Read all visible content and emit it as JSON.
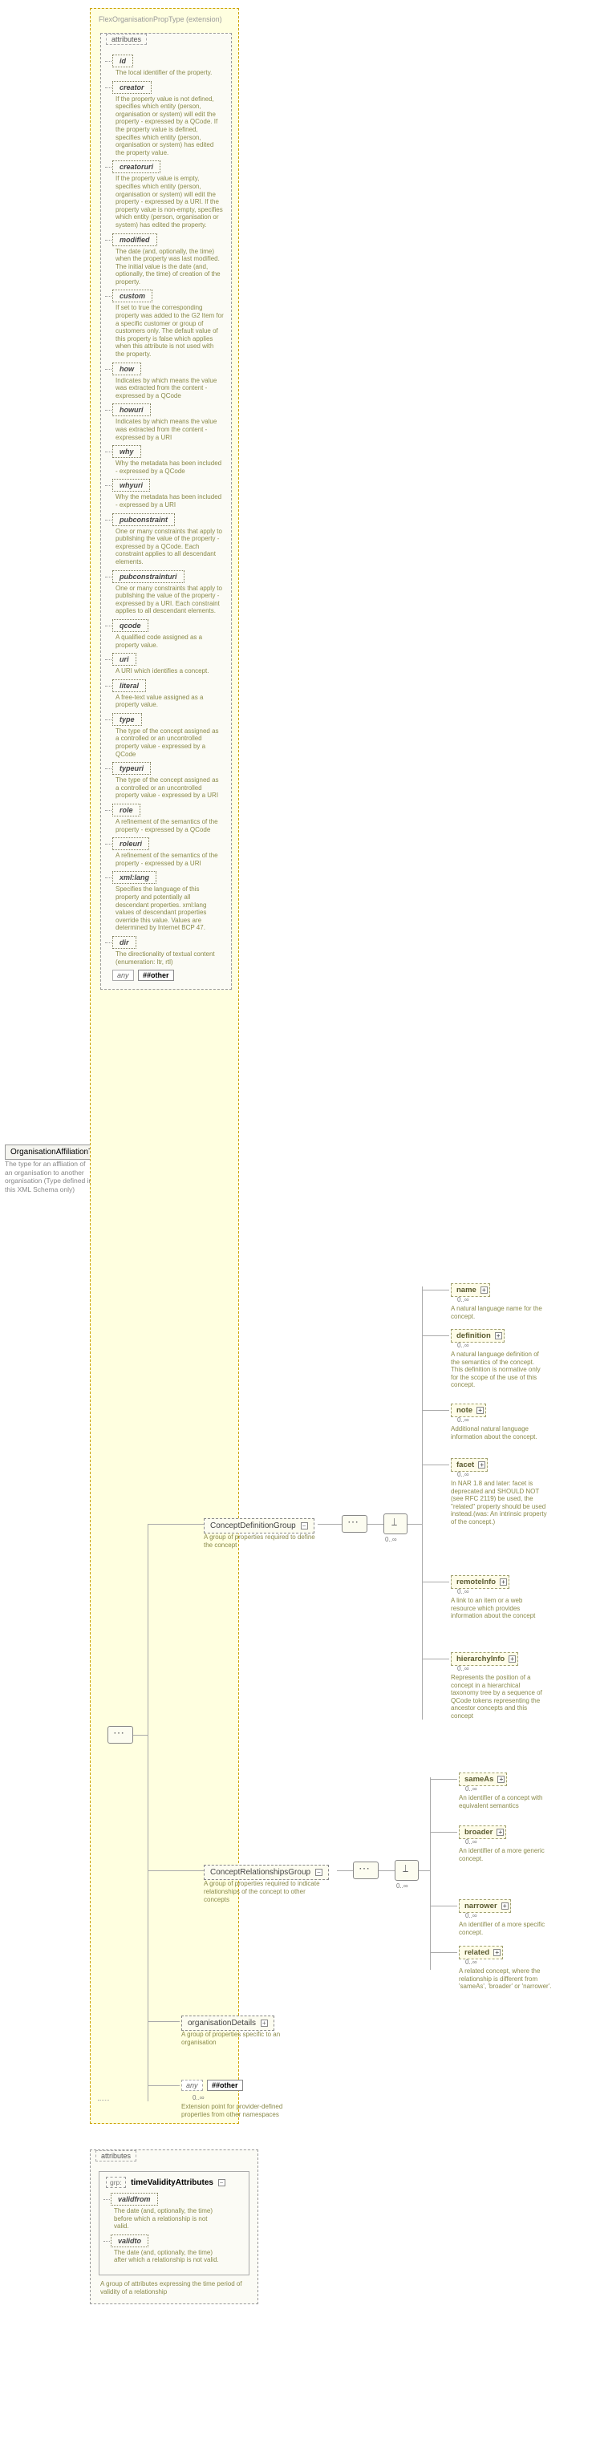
{
  "root": {
    "name": "OrganisationAffiliationType",
    "desc": "The type for an affliation of an organisation to another organisation (Type defined in this XML Schema only)"
  },
  "ext": {
    "label": "FlexOrganisationPropType (extension)"
  },
  "attributes_label": "attributes",
  "any_label": "any",
  "hash_label": "##other",
  "hash_ext_card": "0..∞",
  "hash_ext_desc": "Extension point for provider-defined properties from other namespaces",
  "flex_attrs": [
    {
      "name": "id",
      "desc": "The local identifier of the property."
    },
    {
      "name": "creator",
      "desc": "If the property value is not defined, specifies which entity (person, organisation or system) will edit the property - expressed by a QCode. If the property value is defined, specifies which entity (person, organisation or system) has edited the property value."
    },
    {
      "name": "creatoruri",
      "desc": "If the property value is empty, specifies which entity (person, organisation or system) will edit the property - expressed by a URI. If the property value is non-empty, specifies which entity (person, organisation or system) has edited the property."
    },
    {
      "name": "modified",
      "desc": "The date (and, optionally, the time) when the property was last modified. The initial value is the date (and, optionally, the time) of creation of the property."
    },
    {
      "name": "custom",
      "desc": "If set to true the corresponding property was added to the G2 Item for a specific customer or group of customers only. The default value of this property is false which applies when this attribute is not used with the property."
    },
    {
      "name": "how",
      "desc": "Indicates by which means the value was extracted from the content - expressed by a QCode"
    },
    {
      "name": "howuri",
      "desc": "Indicates by which means the value was extracted from the content - expressed by a URI"
    },
    {
      "name": "why",
      "desc": "Why the metadata has been included - expressed by a QCode"
    },
    {
      "name": "whyuri",
      "desc": "Why the metadata has been included - expressed by a URI"
    },
    {
      "name": "pubconstraint",
      "desc": "One or many constraints that apply to publishing the value of the property - expressed by a QCode. Each constraint applies to all descendant elements."
    },
    {
      "name": "pubconstrainturi",
      "desc": "One or many constraints that apply to publishing the value of the property - expressed by a URI. Each constraint applies to all descendant elements."
    },
    {
      "name": "qcode",
      "desc": "A qualified code assigned as a property value."
    },
    {
      "name": "uri",
      "desc": "A URI which identifies a concept."
    },
    {
      "name": "literal",
      "desc": "A free-text value assigned as a property value."
    },
    {
      "name": "type",
      "desc": "The type of the concept assigned as a controlled or an uncontrolled property value - expressed by a QCode"
    },
    {
      "name": "typeuri",
      "desc": "The type of the concept assigned as a controlled or an uncontrolled property value - expressed by a URI"
    },
    {
      "name": "role",
      "desc": "A refinement of the semantics of the property - expressed by a QCode"
    },
    {
      "name": "roleuri",
      "desc": "A refinement of the semantics of the property - expressed by a URI"
    },
    {
      "name": "xml:lang",
      "desc": "Specifies the language of this property and potentially all descendant properties. xml:lang values of descendant properties override this value. Values are determined by Internet BCP 47."
    },
    {
      "name": "dir",
      "desc": "The directionality of textual content (enumeration: ltr, rtl)"
    }
  ],
  "groups": {
    "cdg": {
      "label": "ConceptDefinitionGroup",
      "desc": "A group of properties required to define the concept"
    },
    "crg": {
      "label": "ConceptRelationshipsGroup",
      "desc": "A group of properties required to indicate relationships of the concept to other concepts"
    },
    "od": {
      "label": "organisationDetails",
      "desc": "A group of properties specific to an organisation"
    }
  },
  "cdg_children": [
    {
      "name": "name",
      "desc": "A natural language name for the concept."
    },
    {
      "name": "definition",
      "desc": "A natural language definition of the semantics of the concept. This definition is normative only for the scope of the use of this concept."
    },
    {
      "name": "note",
      "desc": "Additional natural language information about the concept."
    },
    {
      "name": "facet",
      "desc": "In NAR 1.8 and later: facet is deprecated and SHOULD NOT (see RFC 2119) be used, the \"related\" property should be used instead.(was: An intrinsic property of the concept.)"
    },
    {
      "name": "remoteInfo",
      "desc": "A link to an item or a web resource which provides information about the concept"
    },
    {
      "name": "hierarchyInfo",
      "desc": "Represents the position of a concept in a hierarchical taxonomy tree by a sequence of QCode tokens representing the ancestor concepts and this concept"
    }
  ],
  "crg_children": [
    {
      "name": "sameAs",
      "desc": "An identifier of a concept with equivalent semantics"
    },
    {
      "name": "broader",
      "desc": "An identifier of a more generic concept."
    },
    {
      "name": "narrower",
      "desc": "An identifier of a more specific concept."
    },
    {
      "name": "related",
      "desc": "A related concept, where the relationship is different from 'sameAs', 'broader' or 'narrower'."
    }
  ],
  "card_0inf": "0..∞",
  "tva": {
    "grp_prefix": "grp:",
    "title": "timeValidityAttributes",
    "validfrom": {
      "name": "validfrom",
      "desc": "The date (and, optionally, the time) before which a relationship is not valid."
    },
    "validto": {
      "name": "validto",
      "desc": "The date (and, optionally, the time) after which a relationship is not valid."
    },
    "footer": "A group of attributes expressing the time period of validity of a relationship"
  }
}
